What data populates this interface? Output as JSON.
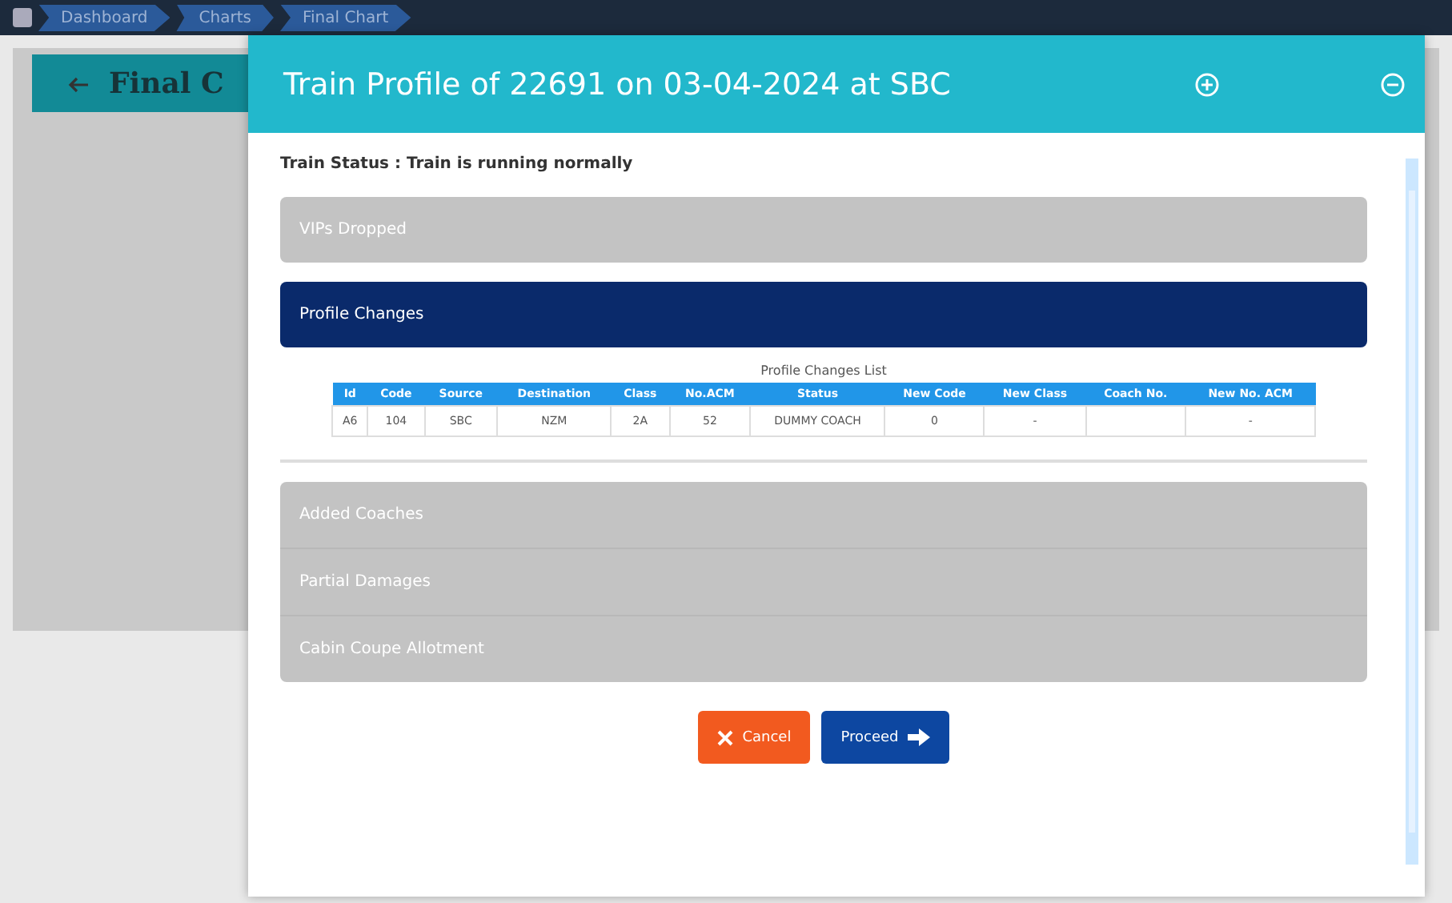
{
  "breadcrumbs": [
    {
      "label": "Dashboard"
    },
    {
      "label": "Charts"
    },
    {
      "label": "Final Chart"
    }
  ],
  "page": {
    "title": "Final C"
  },
  "modal": {
    "title": "Train Profile of 22691 on 03-04-2024 at SBC",
    "status": "Train Status : Train is running normally",
    "sections": [
      {
        "label": "VIPs Dropped",
        "expanded": false
      },
      {
        "label": "Profile Changes",
        "expanded": true,
        "table": {
          "caption": "Profile Changes List",
          "columns": [
            "Id",
            "Code",
            "Source",
            "Destination",
            "Class",
            "No.ACM",
            "Status",
            "New Code",
            "New Class",
            "Coach No.",
            "New No. ACM"
          ],
          "rows": [
            [
              "A6",
              "104",
              "SBC",
              "NZM",
              "2A",
              "52",
              "DUMMY COACH",
              "0",
              "-",
              "",
              "-"
            ]
          ]
        }
      },
      {
        "label": "Added Coaches",
        "expanded": false
      },
      {
        "label": "Partial Damages",
        "expanded": false
      },
      {
        "label": "Cabin Coupe Allotment",
        "expanded": false
      }
    ],
    "buttons": [
      {
        "label": "Cancel",
        "kind": "cancel"
      },
      {
        "label": "Proceed",
        "kind": "proceed"
      }
    ]
  }
}
